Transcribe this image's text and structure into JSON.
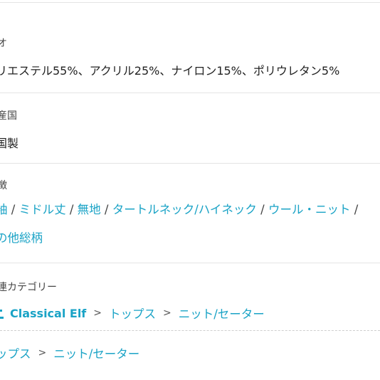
{
  "material": {
    "label": "オ",
    "value": "リエステル55%、アクリル25%、ナイロン15%、ポリウレタン5%"
  },
  "origin": {
    "label": "産国",
    "value": "国製"
  },
  "features": {
    "label": "徴",
    "line1": [
      "袖",
      "ミドル丈",
      "無地",
      "タートルネック/ハイネック",
      "ウール・ニット"
    ],
    "line2": [
      "の他総柄"
    ],
    "separator": "/"
  },
  "related": {
    "label": "連カテゴリー",
    "crumb1": [
      "Classical Elf",
      "トップス",
      "ニット/セーター"
    ],
    "crumb2": [
      "ップス",
      "ニット/セーター"
    ],
    "separator": ">"
  },
  "colors": {
    "link": "#1aa3c6",
    "divider": "#e4e4e4"
  },
  "icons": {
    "brand": "brand-logo-icon"
  }
}
